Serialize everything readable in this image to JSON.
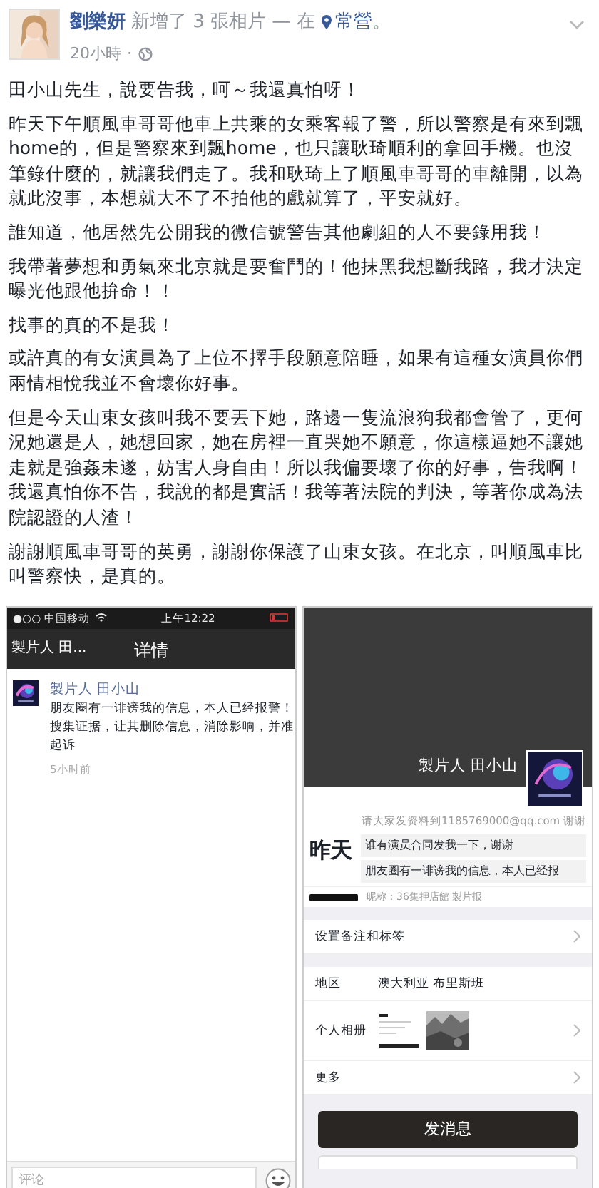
{
  "post": {
    "author": "劉樂妍",
    "action": "新增了 3 張相片 — 在",
    "place": "常營",
    "end": "。",
    "time": "20小時",
    "separator": "·"
  },
  "paragraphs": [
    "田小山先生，說要告我，呵～我還真怕呀！",
    "昨天下午順風車哥哥他車上共乘的女乘客報了警，所以警察是有來到飄home的，但是警察來到飄home，也只讓耿琦順利的拿回手機。也沒筆錄什麼的，就讓我們走了。我和耿琦上了順風車哥哥的車離開，以為就此沒事，本想就大不了不拍他的戲就算了，平安就好。",
    "誰知道，他居然先公開我的微信號警告其他劇組的人不要錄用我！",
    "我帶著夢想和勇氣來北京就是要奮鬥的！他抹黑我想斷我路，我才決定曝光他跟他拚命！！",
    "找事的真的不是我！",
    "或許真的有女演員為了上位不擇手段願意陪睡，如果有這種女演員你們兩情相悅我並不會壞你好事。",
    "但是今天山東女孩叫我不要丟下她，路邊一隻流浪狗我都會管了，更何況她還是人，她想回家，她在房裡一直哭她不願意，你這樣逼她不讓她走就是強姦未遂，妨害人身自由！所以我偏要壞了你的好事，告我啊！我還真怕你不告，我說的都是實話！我等著法院的判決，等著你成為法院認證的人渣！",
    "謝謝順風車哥哥的英勇，謝謝你保護了山東女孩。在北京，叫順風車比叫警察快，是真的。"
  ],
  "photos": [
    {
      "kind": "post_detail",
      "carrier": "●○○ 中国移动",
      "clock": "上午12:22",
      "back": "製片人 田...",
      "title": "详情",
      "name": "製片人 田小山",
      "lines": [
        "朋友圈有一诽谤我的信息，本人已经报警！",
        "搜集证据，让其删除信息，消除影响，并准",
        "起诉"
      ],
      "time": "5小时前",
      "placeholder": "评论"
    },
    {
      "kind": "profile",
      "name": "製片人 田小山",
      "signature": "请大家发资料到1185769000@qq.com 谢谢",
      "feed_label": "昨天",
      "feed": [
        "谁有演员合同发我一下，谢谢",
        "朋友圈有一诽谤我的信息，本人已经报"
      ],
      "nickname": "昵称：36集押店館 製片报",
      "groups": [
        [
          {
            "kind": "link",
            "label": "设置备注和标签"
          }
        ],
        [
          {
            "kind": "info",
            "label": "地区",
            "value": "澳大利亚 布里斯班"
          },
          {
            "kind": "album",
            "label": "个人相册"
          },
          {
            "kind": "link",
            "label": "更多"
          }
        ]
      ],
      "button": "发消息"
    }
  ]
}
